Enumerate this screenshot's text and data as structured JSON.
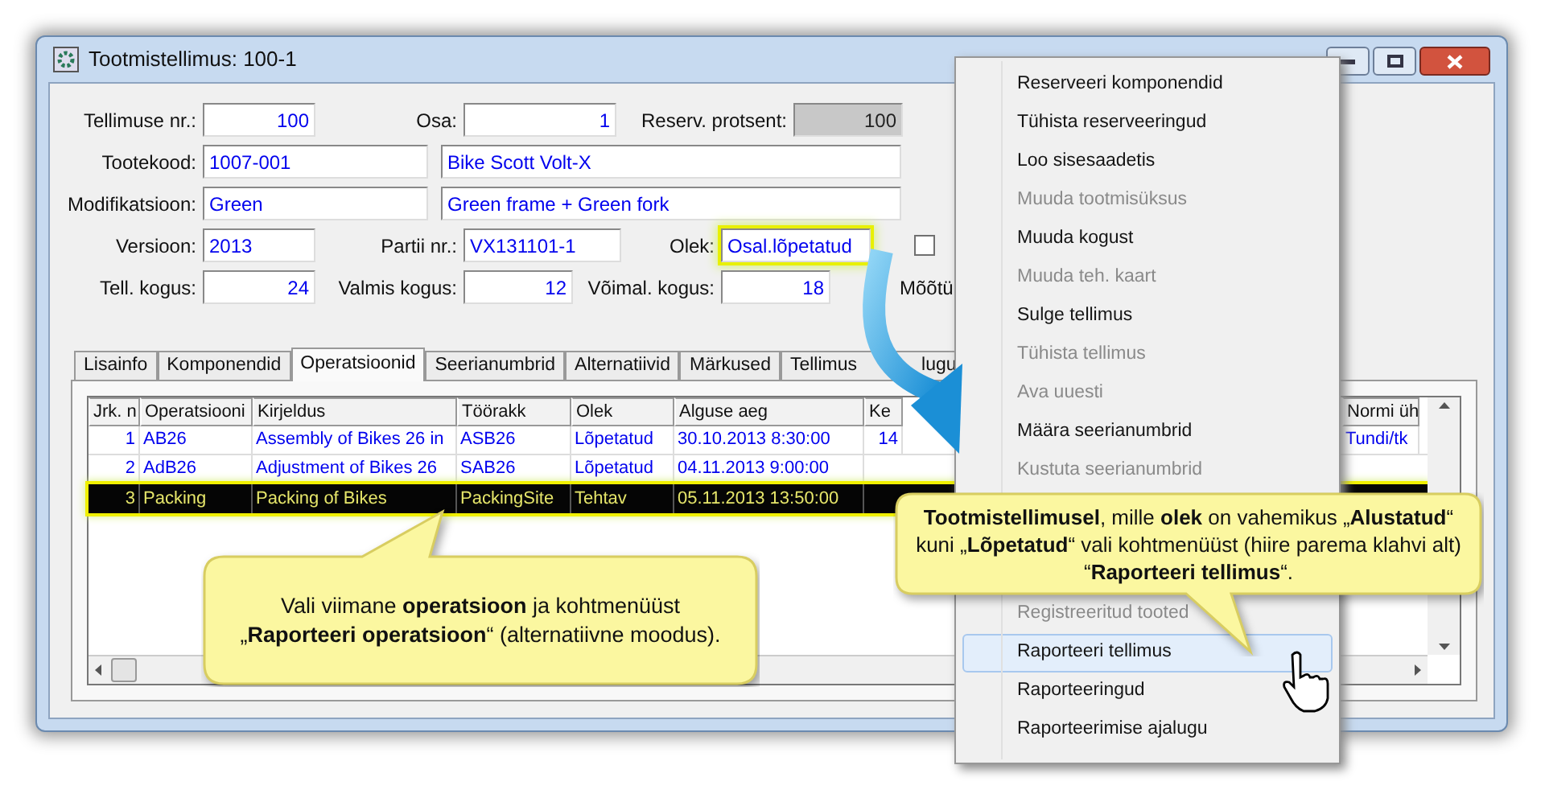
{
  "window": {
    "title": "Tootmistellimus: 100-1"
  },
  "form_rows": [
    [
      {
        "label": "Tellimuse nr.:",
        "value": "100",
        "kind": "number",
        "disabled": false
      },
      {
        "label": "Osa:",
        "value": "1",
        "kind": "number",
        "disabled": false
      },
      {
        "label": "Reserv. protsent:",
        "value": "100",
        "kind": "number",
        "disabled": true
      }
    ],
    [
      {
        "label": "Tootekood:",
        "value": "1007-001",
        "kind": "text",
        "disabled": false
      },
      {
        "value": "Bike Scott Volt-X",
        "kind": "text",
        "disabled": false
      }
    ],
    [
      {
        "label": "Modifikatsioon:",
        "value": "Green",
        "kind": "text",
        "disabled": false
      },
      {
        "value": "Green frame + Green fork",
        "kind": "text",
        "disabled": false
      }
    ],
    [
      {
        "label": "Versioon:",
        "value": "2013",
        "kind": "text",
        "disabled": false
      },
      {
        "label": "Partii nr.:",
        "value": "VX131101-1",
        "kind": "text",
        "disabled": false
      },
      {
        "label": "Olek:",
        "value": "Osal.lõpetatud",
        "kind": "text",
        "disabled": false,
        "highlighted": true
      },
      {
        "kind": "checkbox",
        "checked": false
      }
    ],
    [
      {
        "label": "Tell. kogus:",
        "value": "24",
        "kind": "number",
        "disabled": false
      },
      {
        "label": "Valmis kogus:",
        "value": "12",
        "kind": "number",
        "disabled": false
      },
      {
        "label": "Võimal. kogus:",
        "value": "18",
        "kind": "number",
        "disabled": false
      },
      {
        "label": "Mõõtü",
        "kind": "label"
      }
    ]
  ],
  "tabs": [
    {
      "label": "Lisainfo",
      "selected": false
    },
    {
      "label": "Komponendid",
      "selected": false
    },
    {
      "label": "Operatsioonid",
      "selected": true
    },
    {
      "label": "Seerianumbrid",
      "selected": false
    },
    {
      "label": "Alternatiivid",
      "selected": false
    },
    {
      "label": "Märkused",
      "selected": false
    },
    {
      "label": "Tellimus",
      "label_end": "lugu",
      "selected": false
    }
  ],
  "table": {
    "columns": [
      "Jrk. n",
      "Operatsiooni",
      "Kirjeldus",
      "Töörakk",
      "Olek",
      "Alguse aeg",
      "Ke",
      "Normi üh"
    ],
    "rows": [
      {
        "selected": false,
        "cells": [
          "1",
          "AB26",
          "Assembly of Bikes 26 in",
          "ASB26",
          "Lõpetatud",
          "30.10.2013 8:30:00",
          "14",
          "Tundi/tk"
        ]
      },
      {
        "selected": false,
        "cells": [
          "2",
          "AdB26",
          "Adjustment of Bikes 26",
          "SAB26",
          "Lõpetatud",
          "04.11.2013 9:00:00"
        ]
      },
      {
        "selected": true,
        "cells": [
          "3",
          "Packing",
          "Packing of Bikes",
          "PackingSite",
          "Tehtav",
          "05.11.2013 13:50:00"
        ]
      }
    ]
  },
  "context_menu": {
    "upper_items": [
      {
        "label": "Reserveeri komponendid",
        "disabled": false,
        "selected": false
      },
      {
        "label": "Tühista reserveeringud",
        "disabled": false,
        "selected": false
      },
      {
        "label": "Loo sisesaadetis",
        "disabled": false,
        "selected": false
      },
      {
        "label": "Muuda tootmisüksus",
        "disabled": true,
        "selected": false
      },
      {
        "label": "Muuda kogust",
        "disabled": false,
        "selected": false
      },
      {
        "label": "Muuda teh. kaart",
        "disabled": true,
        "selected": false
      },
      {
        "label": "Sulge tellimus",
        "disabled": false,
        "selected": false
      },
      {
        "label": "Tühista tellimus",
        "disabled": true,
        "selected": false
      },
      {
        "label": "Ava uuesti",
        "disabled": true,
        "selected": false
      },
      {
        "label": "Määra seerianumbrid",
        "disabled": false,
        "selected": false
      },
      {
        "label": "Kustuta seerianumbrid",
        "disabled": true,
        "selected": false
      }
    ],
    "lower_items": [
      {
        "label": "Registreeritud tooted",
        "disabled": true,
        "selected": false
      },
      {
        "label": "Raporteeri tellimus",
        "disabled": false,
        "selected": true
      },
      {
        "label": "Raporteeringud",
        "disabled": false,
        "selected": false
      },
      {
        "label": "Raporteerimise ajalugu",
        "disabled": false,
        "selected": false
      }
    ]
  },
  "callouts": [
    {
      "text": "Vali viimane **operatsioon** ja kohtmenüüst „**Raporteeri operatsioon**“ (alternatiivne moodus)."
    },
    {
      "text": "**Tootmistellimusel**, mille **olek** on vahemikus „**Alustatud**“ kuni „**Lõpetatud**“ vali kohtmenüüst (hiire parema klahvi alt) “**Raporteeri tellimus**“."
    }
  ]
}
